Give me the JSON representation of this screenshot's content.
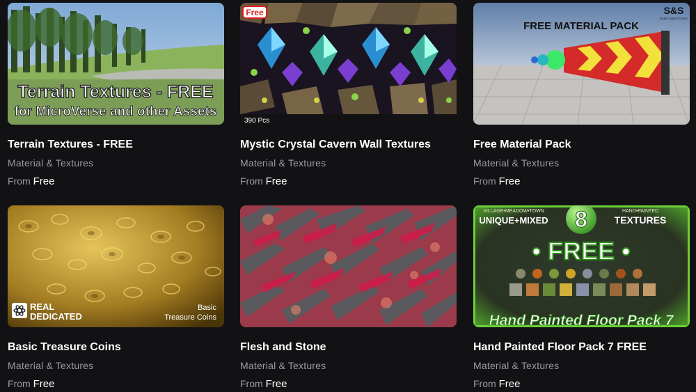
{
  "products": [
    {
      "title": "Terrain Textures - FREE",
      "category": "Material & Textures",
      "price_prefix": "From",
      "price": "Free",
      "thumb_text": [
        "Terrain Textures - FREE",
        "for MicroVerse and other Assets"
      ]
    },
    {
      "title": "Mystic Crystal Cavern Wall Textures",
      "category": "Material & Textures",
      "price_prefix": "From",
      "price": "Free",
      "thumb_text": [
        "Free",
        "390 Pcs"
      ]
    },
    {
      "title": "Free Material Pack",
      "category": "Material & Textures",
      "price_prefix": "From",
      "price": "Free",
      "thumb_text": [
        "FREE MATERIAL PACK",
        "S&S",
        "SOAR GAME STUDIO"
      ]
    },
    {
      "title": "Basic Treasure Coins",
      "category": "Material & Textures",
      "price_prefix": "From",
      "price": "Free",
      "thumb_text": [
        "REAL",
        "DEDICATED",
        "Basic",
        "Treasure Coins"
      ]
    },
    {
      "title": "Flesh and Stone",
      "category": "Material & Textures",
      "price_prefix": "From",
      "price": "Free",
      "thumb_text": []
    },
    {
      "title": "Hand Painted Floor Pack 7 FREE",
      "category": "Material & Textures",
      "price_prefix": "From",
      "price": "Free",
      "thumb_text": [
        "VILLAGE•MEADOW•TOWN",
        "UNIQUE+MIXED",
        "8",
        "HAND•PAINTED",
        "TEXTURES",
        "• FREE •",
        "Hand Painted Floor Pack 7"
      ]
    }
  ]
}
